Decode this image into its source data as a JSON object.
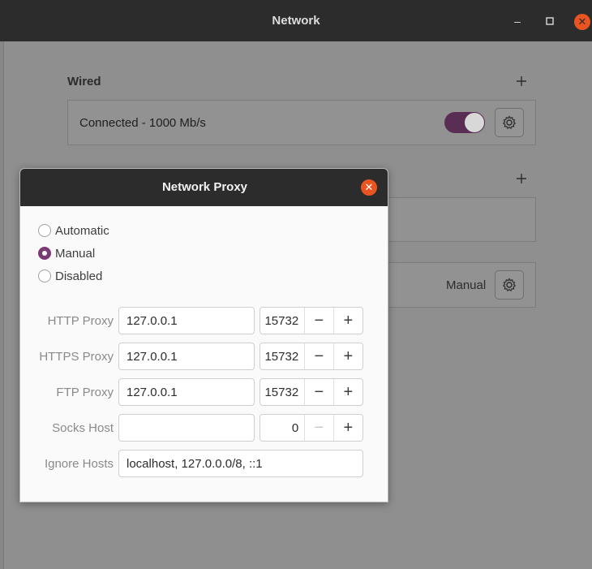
{
  "window": {
    "title": "Network"
  },
  "wired": {
    "section_title": "Wired",
    "status": "Connected - 1000 Mb/s",
    "toggle_on": true
  },
  "vpn": {
    "section_title": ""
  },
  "proxy_card": {
    "status": "Manual"
  },
  "dialog": {
    "title": "Network Proxy",
    "modes": [
      {
        "label": "Automatic",
        "checked": false
      },
      {
        "label": "Manual",
        "checked": true
      },
      {
        "label": "Disabled",
        "checked": false
      }
    ],
    "http": {
      "label": "HTTP Proxy",
      "host": "127.0.0.1",
      "port": "15732"
    },
    "https": {
      "label": "HTTPS Proxy",
      "host": "127.0.0.1",
      "port": "15732"
    },
    "ftp": {
      "label": "FTP Proxy",
      "host": "127.0.0.1",
      "port": "15732"
    },
    "socks": {
      "label": "Socks Host",
      "host": "",
      "port": "0"
    },
    "ignore": {
      "label": "Ignore Hosts",
      "value": "localhost, 127.0.0.0/8, ::1"
    }
  },
  "colors": {
    "accent": "#7a3b73",
    "close": "#e95420",
    "titlebar": "#2c2c2c"
  },
  "icons": {
    "minimize": "minimize-icon",
    "maximize": "maximize-icon",
    "close": "close-icon",
    "add": "plus-icon",
    "settings": "gear-icon",
    "decrement": "minus-icon",
    "increment": "plus-icon"
  }
}
